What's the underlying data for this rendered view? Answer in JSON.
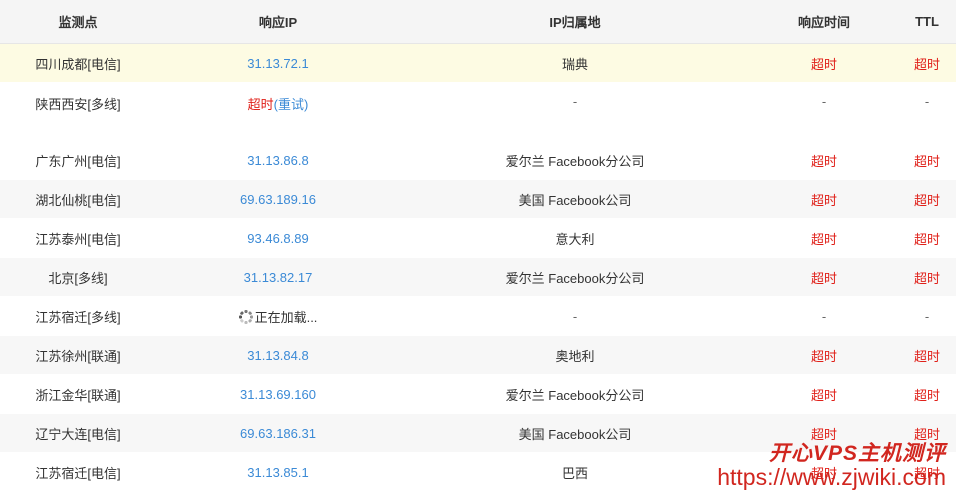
{
  "columns": {
    "location": "监测点",
    "ip": "响应IP",
    "geo": "IP归属地",
    "time": "响应时间",
    "ttl": "TTL"
  },
  "rows": [
    {
      "location": "四川成都[电信]",
      "ip": "31.13.72.1",
      "geo": "瑞典",
      "time": "超时",
      "ttl": "超时"
    },
    {
      "location": "陕西西安[多线]",
      "ip_timeout": "超时",
      "retry": "(重试)",
      "geo": "-",
      "time": "-",
      "ttl": "-"
    },
    {
      "location": "广东广州[电信]",
      "ip": "31.13.86.8",
      "geo": "爱尔兰 Facebook分公司",
      "time": "超时",
      "ttl": "超时"
    },
    {
      "location": "湖北仙桃[电信]",
      "ip": "69.63.189.16",
      "geo": "美国 Facebook公司",
      "time": "超时",
      "ttl": "超时"
    },
    {
      "location": "江苏泰州[电信]",
      "ip": "93.46.8.89",
      "geo": "意大利",
      "time": "超时",
      "ttl": "超时"
    },
    {
      "location": "北京[多线]",
      "ip": "31.13.82.17",
      "geo": "爱尔兰 Facebook分公司",
      "time": "超时",
      "ttl": "超时"
    },
    {
      "location": "江苏宿迁[多线]",
      "loading": "正在加载...",
      "geo": "-",
      "time": "-",
      "ttl": "-"
    },
    {
      "location": "江苏徐州[联通]",
      "ip": "31.13.84.8",
      "geo": "奥地利",
      "time": "超时",
      "ttl": "超时"
    },
    {
      "location": "浙江金华[联通]",
      "ip": "31.13.69.160",
      "geo": "爱尔兰 Facebook分公司",
      "time": "超时",
      "ttl": "超时"
    },
    {
      "location": "辽宁大连[电信]",
      "ip": "69.63.186.31",
      "geo": "美国 Facebook公司",
      "time": "超时",
      "ttl": "超时"
    },
    {
      "location": "江苏宿迁[电信]",
      "ip": "31.13.85.1",
      "geo": "巴西",
      "time": "超时",
      "ttl": "超时"
    }
  ],
  "watermark": {
    "title": "开心VPS主机测评",
    "url": "https://www.zjwiki.com"
  },
  "colors": {
    "ip_link": "#3b8ad6",
    "timeout": "#e0211a",
    "highlight_row": "#fdfbe3",
    "header_bg": "#f5f5f5",
    "watermark": "#d1261f"
  }
}
